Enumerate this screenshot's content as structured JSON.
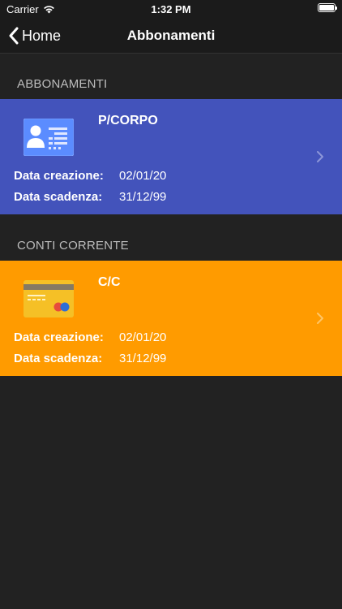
{
  "status_bar": {
    "carrier": "Carrier",
    "time": "1:32 PM",
    "icons": [
      "wifi-icon",
      "battery-icon"
    ]
  },
  "nav": {
    "back_label": "Home",
    "title": "Abbonamenti",
    "back_icon": "chevron-left-icon"
  },
  "sections": [
    {
      "header": "ABBONAMENTI",
      "cards": [
        {
          "title": "P/CORPO",
          "icon": "id-card-icon",
          "color": "#4353bb",
          "created_label": "Data creazione:",
          "created_value": "02/01/20",
          "expiry_label": "Data scadenza:",
          "expiry_value": "31/12/99"
        }
      ]
    },
    {
      "header": "CONTI CORRENTE",
      "cards": [
        {
          "title": "C/C",
          "icon": "credit-card-icon",
          "color": "#ff9b00",
          "created_label": "Data creazione:",
          "created_value": "02/01/20",
          "expiry_label": "Data scadenza:",
          "expiry_value": "31/12/99"
        }
      ]
    }
  ],
  "colors": {
    "background": "#222222",
    "bar": "#1b1b1b",
    "section_text": "#bdbdbd"
  }
}
